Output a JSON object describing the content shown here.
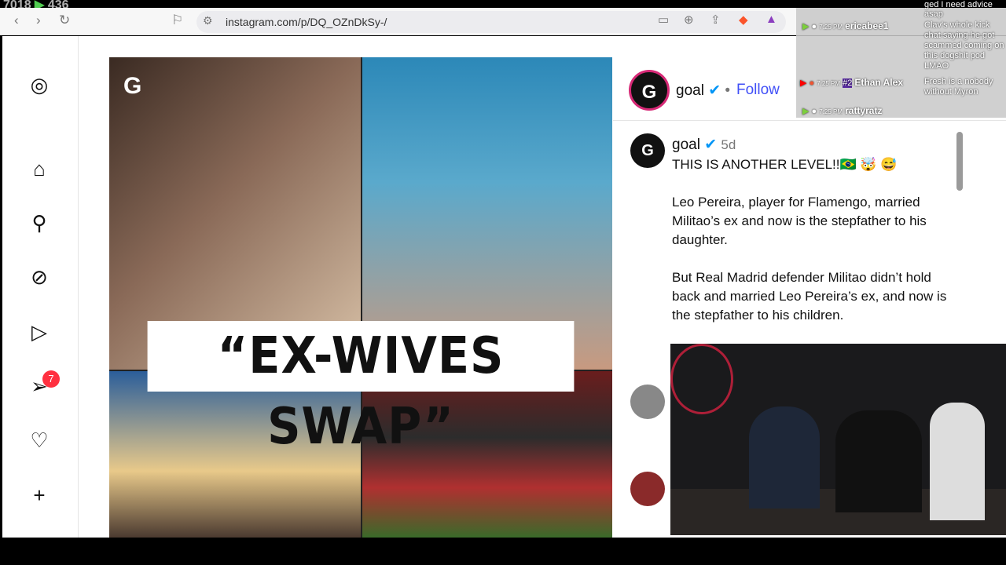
{
  "stream": {
    "counter": "7018",
    "viewers": "436"
  },
  "browser": {
    "url": "instagram.com/p/DQ_OZnDkSy-/"
  },
  "sidebar": {
    "notification_count": "7"
  },
  "post": {
    "headline": "“EX-WIVES SWAP”",
    "logo": "G"
  },
  "author": {
    "name": "goal",
    "follow": "Follow",
    "dot": "•",
    "time": "5d"
  },
  "caption": {
    "title": "THIS IS ANOTHER LEVEL!!🇧🇷 🤯 😅",
    "body": "Leo Pereira, player for Flamengo, married Militao’s ex and now is the stepfather to his daughter.\n\nBut Real Madrid defender Militao didn’t hold back and married Leo Pereira’s ex, and now is the stepfather to his children."
  },
  "chat": {
    "messages": [
      {
        "time": "7:25 PM",
        "user": "ericabee1",
        "text": "ged I need advice asap"
      },
      {
        "time": "",
        "user": "",
        "text": "Clav's whole kick chat saying he got scammed coming on this dogshit pod LMAO"
      },
      {
        "time": "7:25 PM",
        "user": "Ethan Alex",
        "badge": "#2",
        "text": "Fresh is a nobody without Myron"
      },
      {
        "time": "7:25 PM",
        "user": "rattyratz",
        "text": ""
      }
    ]
  }
}
